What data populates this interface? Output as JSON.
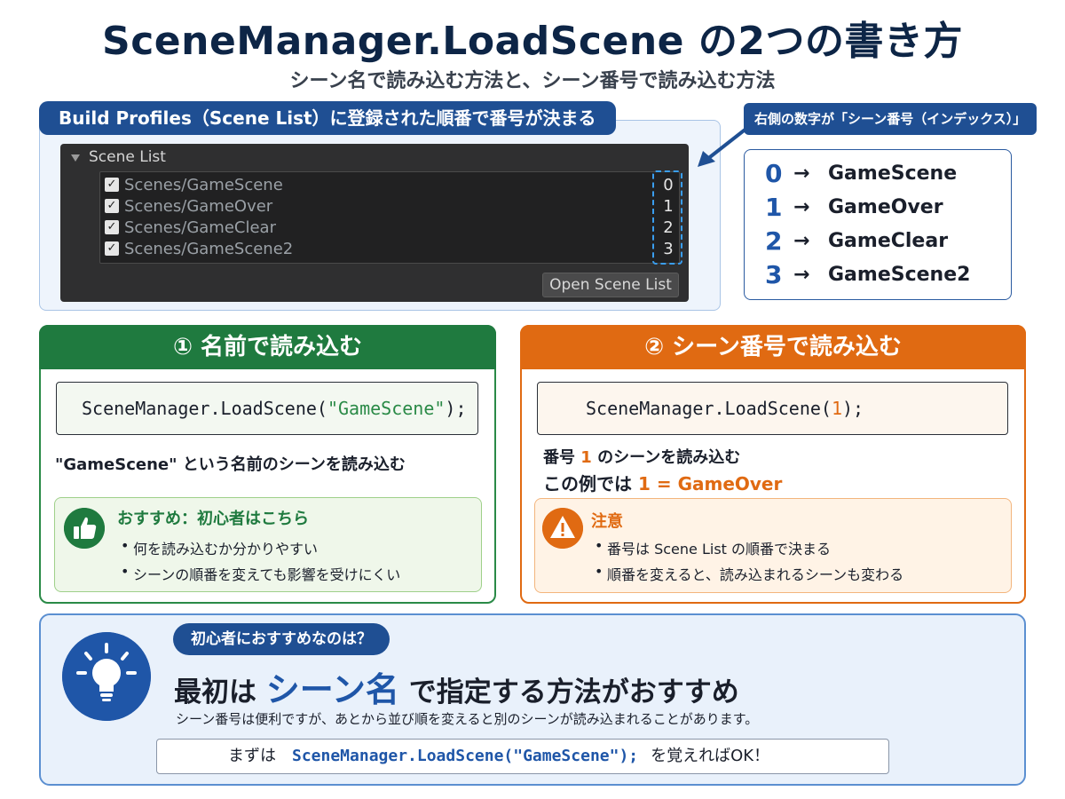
{
  "header": {
    "title": "SceneManager.LoadScene の2つの書き方",
    "subtitle": "シーン名で読み込む方法と、シーン番号で読み込む方法"
  },
  "scene_panel": {
    "banner": "Build Profiles（Scene List）に登録された順番で番号が決まる",
    "list_header": "Scene List",
    "rows": [
      {
        "name": "Scenes/GameScene",
        "index": "0"
      },
      {
        "name": "Scenes/GameOver",
        "index": "1"
      },
      {
        "name": "Scenes/GameClear",
        "index": "2"
      },
      {
        "name": "Scenes/GameScene2",
        "index": "3"
      }
    ],
    "open_button": "Open Scene List"
  },
  "callout": {
    "label": "右側の数字が「シーン番号（インデックス）」",
    "mapping": [
      {
        "num": "0",
        "arrow": "→",
        "scene": "GameScene"
      },
      {
        "num": "1",
        "arrow": "→",
        "scene": "GameOver"
      },
      {
        "num": "2",
        "arrow": "→",
        "scene": "GameClear"
      },
      {
        "num": "3",
        "arrow": "→",
        "scene": "GameScene2"
      }
    ]
  },
  "by_name": {
    "heading": "① 名前で読み込む",
    "code_prefix": "SceneManager.LoadScene(",
    "code_arg": "\"GameScene\"",
    "code_suffix": ");",
    "description": "\"GameScene\" という名前のシーンを読み込む",
    "note_title": "おすすめ：初心者はこちら",
    "note_items": [
      "何を読み込むか分かりやすい",
      "シーンの順番を変えても影響を受けにくい"
    ]
  },
  "by_number": {
    "heading": "② シーン番号で読み込む",
    "code_prefix": "SceneManager.LoadScene(",
    "code_arg": "1",
    "code_suffix": ");",
    "desc1_a": "番号",
    "desc1_num": "1",
    "desc1_b": "のシーンを読み込む",
    "desc2_a": "この例では",
    "desc2_b": "1 = GameOver",
    "note_title": "注意",
    "note_items": [
      "番号は Scene List の順番で決まる",
      "順番を変えると、読み込まれるシーンも変わる"
    ]
  },
  "bottom": {
    "pill": "初心者におすすめなのは？",
    "headline_a": "最初は",
    "headline_big": "シーン名",
    "headline_b": "で指定する方法がおすすめ",
    "text": "シーン番号は便利ですが、あとから並び順を変えると別のシーンが読み込まれることがあります。",
    "code_pre": "まずは",
    "code": "SceneManager.LoadScene(\"GameScene\");",
    "code_post": "を覚えればOK！"
  },
  "colors": {
    "navy": "#0d2546",
    "blue": "#1f56a8",
    "green": "#1f7a3f",
    "orange": "#e06a12"
  }
}
